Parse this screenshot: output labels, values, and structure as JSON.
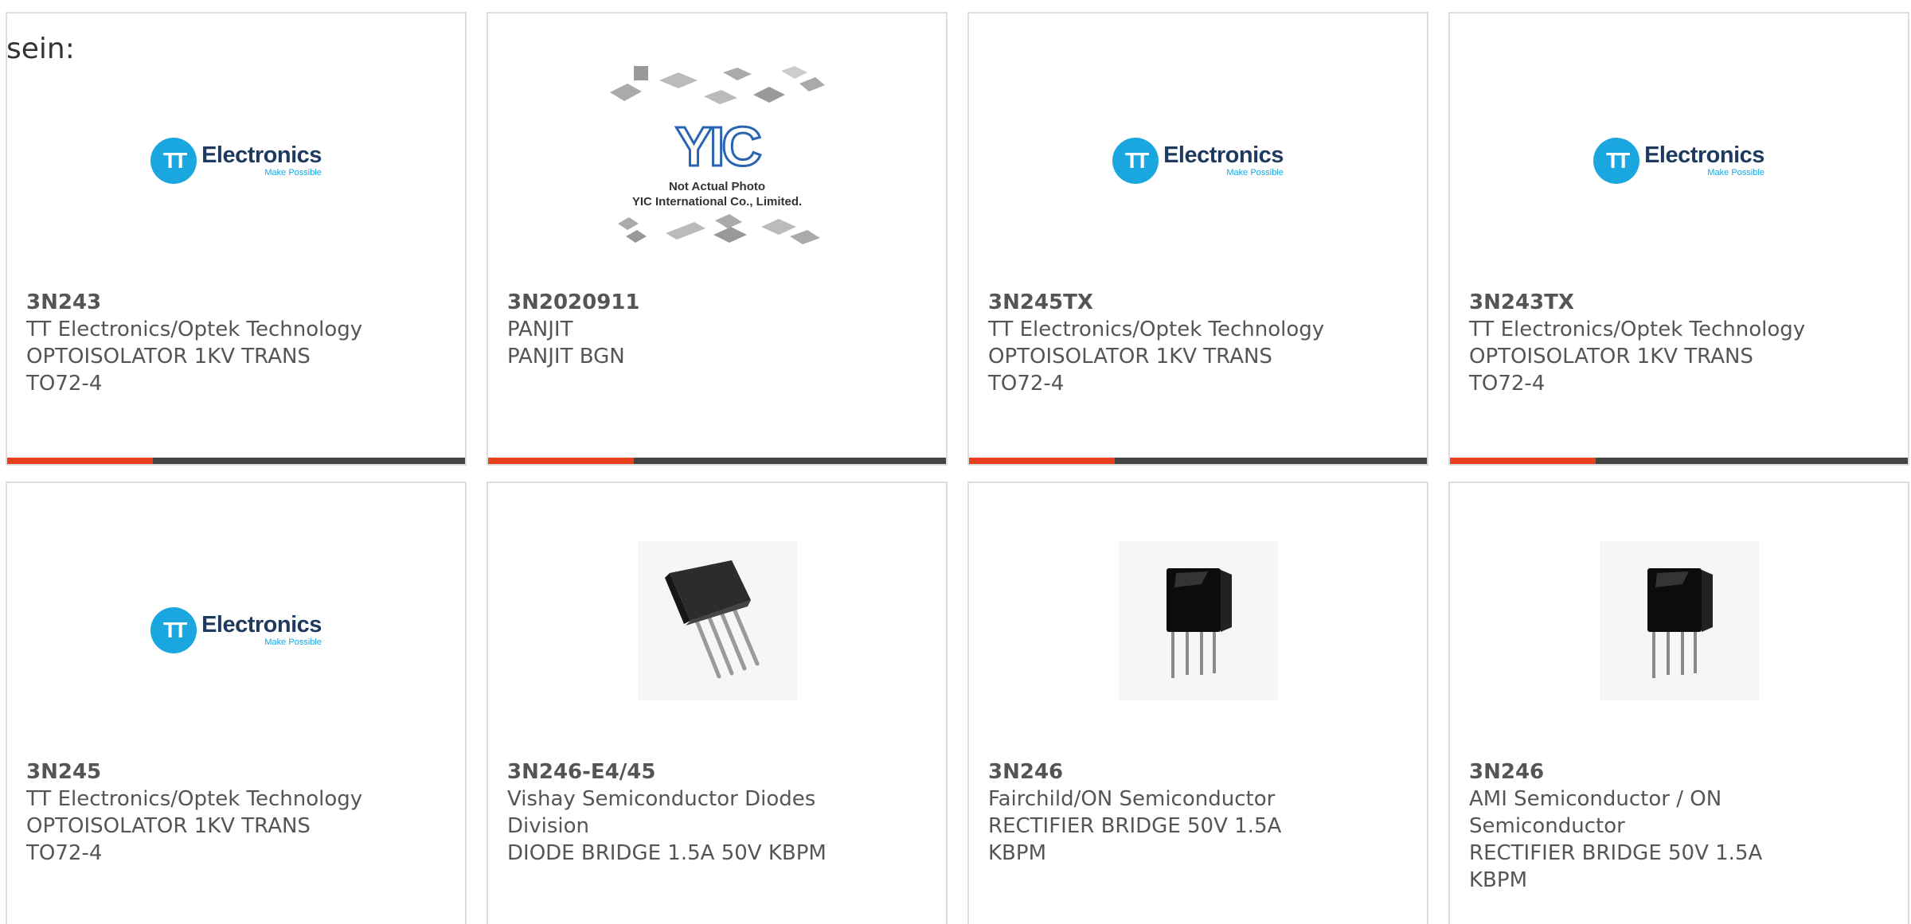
{
  "intro_text": "sein:",
  "products": [
    {
      "part_number": "3N243",
      "manufacturer": "TT Electronics/Optek Technology",
      "description": "OPTOISOLATOR 1KV TRANS",
      "package": "TO72-4",
      "image": "tt-electronics-logo"
    },
    {
      "part_number": "3N2020911",
      "manufacturer": "PANJIT",
      "description": "PANJIT BGN",
      "package": "",
      "image": "yic-placeholder"
    },
    {
      "part_number": "3N245TX",
      "manufacturer": "TT Electronics/Optek Technology",
      "description": "OPTOISOLATOR 1KV TRANS",
      "package": "TO72-4",
      "image": "tt-electronics-logo"
    },
    {
      "part_number": "3N243TX",
      "manufacturer": "TT Electronics/Optek Technology",
      "description": "OPTOISOLATOR 1KV TRANS",
      "package": "TO72-4",
      "image": "tt-electronics-logo"
    },
    {
      "part_number": "3N245",
      "manufacturer": "TT Electronics/Optek Technology",
      "description": "OPTOISOLATOR 1KV TRANS",
      "package": "TO72-4",
      "image": "tt-electronics-logo"
    },
    {
      "part_number": "3N246-E4/45",
      "manufacturer": "Vishay Semiconductor Diodes Division",
      "description": "DIODE BRIDGE 1.5A 50V KBPM",
      "package": "",
      "image": "bridge-rectifier-angled"
    },
    {
      "part_number": "3N246",
      "manufacturer": "Fairchild/ON Semiconductor",
      "description": "RECTIFIER BRIDGE 50V 1.5A",
      "package": "KBPM",
      "image": "bridge-rectifier-front"
    },
    {
      "part_number": "3N246",
      "manufacturer": "AMI Semiconductor / ON Semiconductor",
      "description": "RECTIFIER BRIDGE 50V 1.5A",
      "package": "KBPM",
      "image": "bridge-rectifier-front"
    }
  ],
  "logos": {
    "tt_initials": "TT",
    "tt_name": "Electronics",
    "tt_tagline": "Make Possible",
    "yic_letters": "YIC",
    "yic_note_line1": "Not Actual Photo",
    "yic_note_line2": "YIC International Co., Limited."
  },
  "colors": {
    "accent": "#e8401c",
    "bar_dark": "#444444",
    "tt_blue": "#1aa7e0",
    "text": "#555555"
  }
}
